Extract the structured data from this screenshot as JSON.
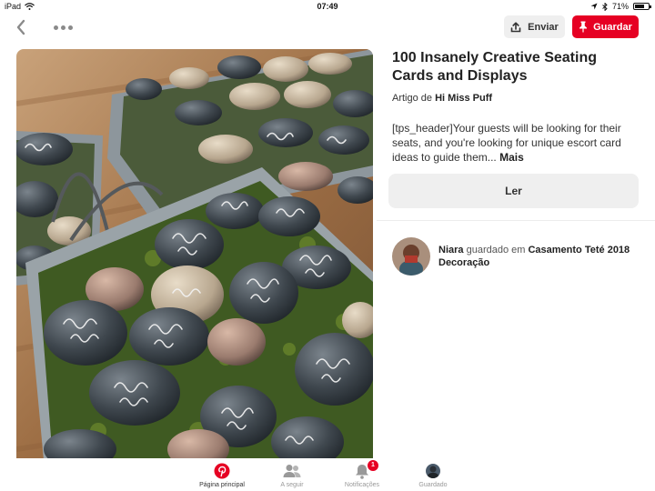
{
  "status_bar": {
    "device": "iPad",
    "time": "07:49",
    "battery": "71%",
    "battery_level": 0.71
  },
  "toolbar": {
    "send_label": "Enviar",
    "save_label": "Guardar"
  },
  "pin": {
    "title": "100 Insanely Creative Seating Cards and Displays",
    "article_prefix": "Artigo de",
    "author": "Hi Miss Puff",
    "description": "[tps_header]Your guests will be looking for their seats, and you're looking for unique escort card ideas to guide them...",
    "more_label": "Mais",
    "read_label": "Ler"
  },
  "saved_by": {
    "user": "Niara",
    "middle_text": "guardado em",
    "board": "Casamento Teté 2018 Decoração"
  },
  "tabs": [
    {
      "label": "Página principal",
      "icon": "pinterest-logo-icon",
      "active": true
    },
    {
      "label": "A seguir",
      "icon": "people-icon",
      "active": false
    },
    {
      "label": "Notificações",
      "icon": "bell-icon",
      "active": false,
      "badge": "1"
    },
    {
      "label": "Guardado",
      "icon": "profile-avatar-icon",
      "active": false
    }
  ],
  "colors": {
    "brand_red": "#e60023",
    "button_gray": "#efefef"
  }
}
